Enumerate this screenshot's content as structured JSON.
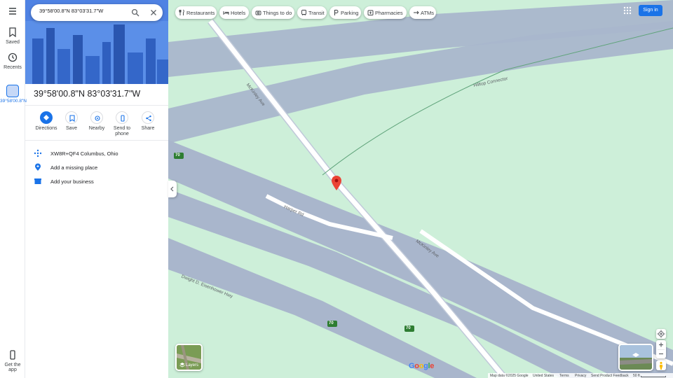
{
  "search": {
    "value": "39°58'00.8\"N 83°03'31.7\"W"
  },
  "rail": {
    "saved": "Saved",
    "recents": "Recents",
    "place_label": "39°58'00.8\"N",
    "get_app": "Get the app"
  },
  "chips": [
    {
      "label": "Restaurants",
      "icon": "fork-knife-icon"
    },
    {
      "label": "Hotels",
      "icon": "bed-icon"
    },
    {
      "label": "Things to do",
      "icon": "camera-icon"
    },
    {
      "label": "Transit",
      "icon": "train-icon"
    },
    {
      "label": "Parking",
      "icon": "parking-icon"
    },
    {
      "label": "Pharmacies",
      "icon": "pill-icon"
    },
    {
      "label": "ATMs",
      "icon": "atm-icon"
    }
  ],
  "signin": "Sign in",
  "place": {
    "title": "39°58'00.8\"N 83°03'31.7\"W"
  },
  "actions": {
    "directions": "Directions",
    "save": "Save",
    "nearby": "Nearby",
    "send_to_phone": "Send to phone",
    "share": "Share"
  },
  "info": {
    "plus_code": "XW8R+QF4 Columbus, Ohio",
    "add_missing": "Add a missing place",
    "add_business": "Add your business"
  },
  "map": {
    "streets": [
      "McKinley Ave",
      "Hilltop Connector",
      "Harper Rd",
      "Dwight D. Eisenhower Hwy"
    ],
    "route_shield": "70",
    "water_color": "#cdefd9",
    "road_color": "#8a9bb8",
    "pin_color": "#ea4335"
  },
  "layers": "Layers",
  "logo": "Google",
  "footer": {
    "map_data": "Map data ©2025 Google",
    "country": "United States",
    "terms": "Terms",
    "privacy": "Privacy",
    "feedback": "Send Product Feedback",
    "scale": "50 ft"
  }
}
